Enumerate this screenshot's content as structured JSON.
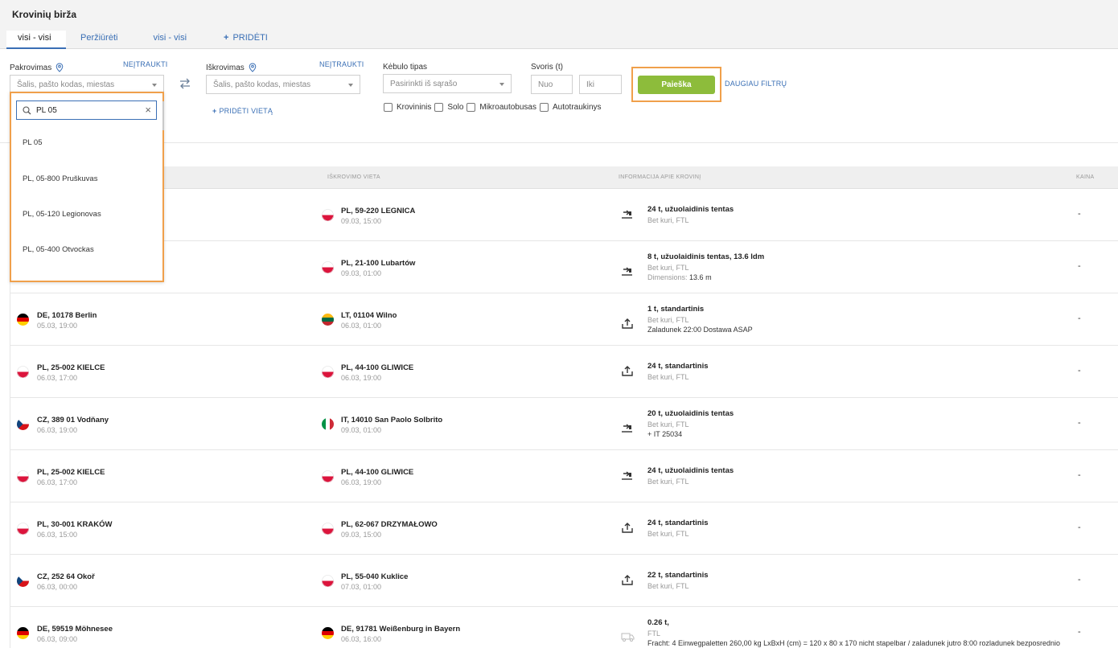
{
  "page_title": "Krovinių birža",
  "tabs": [
    {
      "label": "visi - visi"
    },
    {
      "label": "Peržiūrėti"
    },
    {
      "label": "visi - visi"
    },
    {
      "label": "PRIDĖTI"
    }
  ],
  "filters": {
    "loading": {
      "label": "Pakrovimas",
      "exclude": "NEĮTRAUKTI",
      "placeholder": "Šalis, pašto kodas, miestas"
    },
    "unloading": {
      "label": "Iškrovimas",
      "exclude": "NEĮTRAUKTI",
      "placeholder": "Šalis, pašto kodas, miestas",
      "add_place": "PRIDĖTI VIETĄ"
    },
    "body": {
      "label": "Kėbulo tipas",
      "placeholder": "Pasirinkti iš sąrašo",
      "checkboxes": [
        "Krovininis",
        "Solo",
        "Mikroautobusas",
        "Autotraukinys"
      ]
    },
    "weight": {
      "label": "Svoris (t)",
      "from_placeholder": "Nuo",
      "to_placeholder": "Iki"
    },
    "search_button": "Paieška",
    "more_filters": "DAUGIAU FILTRŲ"
  },
  "dropdown": {
    "search_value": "PL 05",
    "options": [
      "PL 05",
      "PL, 05-800 Pruškuvas",
      "PL, 05-120 Legionovas",
      "PL, 05-400 Otvockas"
    ]
  },
  "table": {
    "headers": {
      "unloading": "IŠKROVIMO VIETA",
      "info": "INFORMACIJA APIE KROVINĮ",
      "price": "KAINA"
    },
    "rows": [
      {
        "from": "",
        "from_date": "",
        "from_flag": "",
        "to": "PL, 59-220 LEGNICA",
        "to_date": "09.03, 15:00",
        "to_flag": "pl",
        "cargo": "24 t, užuolaidinis tentas",
        "sub": "Bet kuri, FTL",
        "extra": "",
        "extra_label": "",
        "icon": "load-side-icon",
        "price": "-"
      },
      {
        "from": "",
        "from_date": "",
        "from_flag": "",
        "to": "PL, 21-100 Lubartów",
        "to_date": "09.03, 01:00",
        "to_flag": "pl",
        "cargo": "8 t, užuolaidinis tentas, 13.6 ldm",
        "sub": "Bet kuri, FTL",
        "extra_label": "Dimensions:",
        "extra": "13.6 m",
        "icon": "load-side-icon",
        "price": "-"
      },
      {
        "from": "DE, 10178 Berlin",
        "from_date": "05.03, 19:00",
        "from_flag": "de",
        "to": "LT, 01104 Wilno",
        "to_date": "06.03, 01:00",
        "to_flag": "lt",
        "cargo": "1 t, standartinis",
        "sub": "Bet kuri, FTL",
        "extra_label": "",
        "extra": "Zaladunek 22:00 Dostawa ASAP",
        "icon": "load-top-icon",
        "price": "-"
      },
      {
        "from": "PL, 25-002 KIELCE",
        "from_date": "06.03, 17:00",
        "from_flag": "pl",
        "to": "PL, 44-100 GLIWICE",
        "to_date": "06.03, 19:00",
        "to_flag": "pl",
        "cargo": "24 t, standartinis",
        "sub": "Bet kuri, FTL",
        "extra_label": "",
        "extra": "",
        "icon": "load-top-icon",
        "price": "-"
      },
      {
        "from": "CZ, 389 01 Vodňany",
        "from_date": "06.03, 19:00",
        "from_flag": "cz",
        "to": "IT, 14010 San Paolo Solbrito",
        "to_date": "09.03, 01:00",
        "to_flag": "it",
        "cargo": "20 t, užuolaidinis tentas",
        "sub": "Bet kuri, FTL",
        "extra_label": "",
        "extra": "+ IT 25034",
        "icon": "load-side-icon",
        "price": "-"
      },
      {
        "from": "PL, 25-002 KIELCE",
        "from_date": "06.03, 17:00",
        "from_flag": "pl",
        "to": "PL, 44-100 GLIWICE",
        "to_date": "06.03, 19:00",
        "to_flag": "pl",
        "cargo": "24 t, užuolaidinis tentas",
        "sub": "Bet kuri, FTL",
        "extra_label": "",
        "extra": "",
        "icon": "load-side-icon",
        "price": "-"
      },
      {
        "from": "PL, 30-001 KRAKÓW",
        "from_date": "06.03, 15:00",
        "from_flag": "pl",
        "to": "PL, 62-067 DRZYMAŁOWO",
        "to_date": "09.03, 15:00",
        "to_flag": "pl",
        "cargo": "24 t, standartinis",
        "sub": "Bet kuri, FTL",
        "extra_label": "",
        "extra": "",
        "icon": "load-top-icon",
        "price": "-"
      },
      {
        "from": "CZ, 252 64 Okoř",
        "from_date": "06.03, 00:00",
        "from_flag": "cz",
        "to": "PL, 55-040 Kuklice",
        "to_date": "07.03, 01:00",
        "to_flag": "pl",
        "cargo": "22 t, standartinis",
        "sub": "Bet kuri, FTL",
        "extra_label": "",
        "extra": "",
        "icon": "load-top-icon",
        "price": "-"
      },
      {
        "from": "DE, 59519 Möhnesee",
        "from_date": "06.03, 09:00",
        "from_flag": "de",
        "to": "DE, 91781 Weißenburg in Bayern",
        "to_date": "06.03, 16:00",
        "to_flag": "de",
        "cargo": "0.26 t,",
        "sub": "FTL",
        "extra_label": "",
        "extra": "Fracht: 4 Einwegpaletten 260,00 kg LxBxH (cm) = 120 x 80 x 170 nicht stapelbar / zaladunek jutro 8:00 rozladunek bezposrednio",
        "icon": "truck-icon",
        "price": "-"
      }
    ]
  }
}
